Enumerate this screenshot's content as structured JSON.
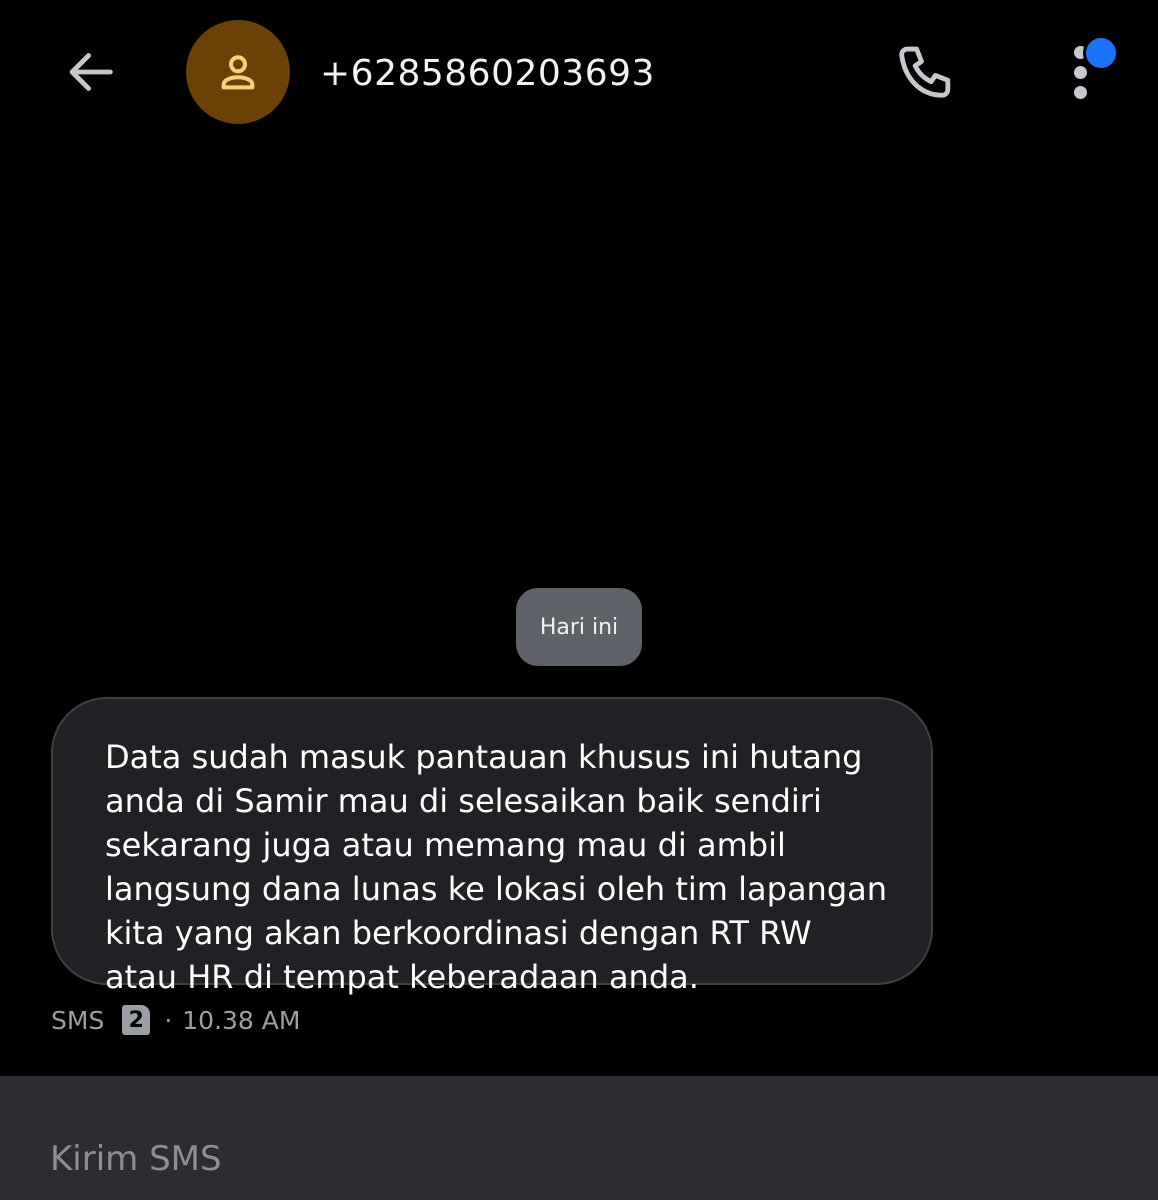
{
  "header": {
    "contact_number": "+6285860203693",
    "icons": {
      "back": "arrow-left-icon",
      "avatar": "person-icon",
      "call": "phone-icon",
      "more": "more-vertical-icon",
      "notification": "notification-dot"
    }
  },
  "conversation": {
    "date_label": "Hari ini",
    "messages": [
      {
        "text": "Data sudah masuk pantauan khusus ini hutang anda di Samir mau di selesaikan baik sendiri sekarang juga atau memang mau di ambil langsung dana lunas ke lokasi oleh tim lapangan kita yang akan berkoordinasi dengan RT RW atau HR di tempat keberadaan anda.",
        "type_label": "SMS",
        "sim_slot": "2",
        "separator": "·",
        "time": "10.38 AM"
      }
    ]
  },
  "composer": {
    "placeholder": "Kirim SMS",
    "value": ""
  },
  "colors": {
    "background": "#000000",
    "icon": "#c6c8ce",
    "avatar_bg": "#6b4106",
    "avatar_icon": "#f8d07a",
    "notification": "#1a73f8",
    "chip_bg": "#5f6268",
    "bubble_bg": "#202124",
    "meta_text": "#9aa0a6",
    "composer_bg": "#2c2d31"
  }
}
